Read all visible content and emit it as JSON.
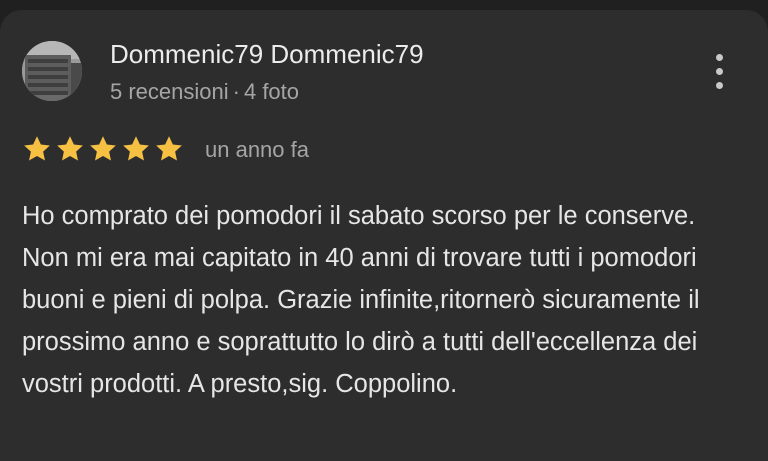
{
  "review": {
    "author_name": "Dommenic79 Dommenic79",
    "reviews_count": "5 recensioni",
    "separator": "·",
    "photos_count": "4 foto",
    "rating": 5,
    "rating_max": 5,
    "time_ago": "un anno fa",
    "text": "Ho comprato dei pomodori il sabato scorso per le conserve. Non mi era mai capitato in 40 anni di trovare tutti i pomodori buoni e pieni di polpa. Grazie infinite,ritornerò sicuramente il prossimo anno e soprattutto lo dirò a tutti dell'eccellenza dei vostri prodotti. A presto,sig. Coppolino."
  },
  "colors": {
    "background": "#2d2d2d",
    "star": "#f6c043",
    "primary_text": "#ececec",
    "secondary_text": "#a5a5a5"
  },
  "icons": {
    "menu": "more-vert-icon",
    "star": "star-icon",
    "avatar": "profile-photo-building"
  }
}
